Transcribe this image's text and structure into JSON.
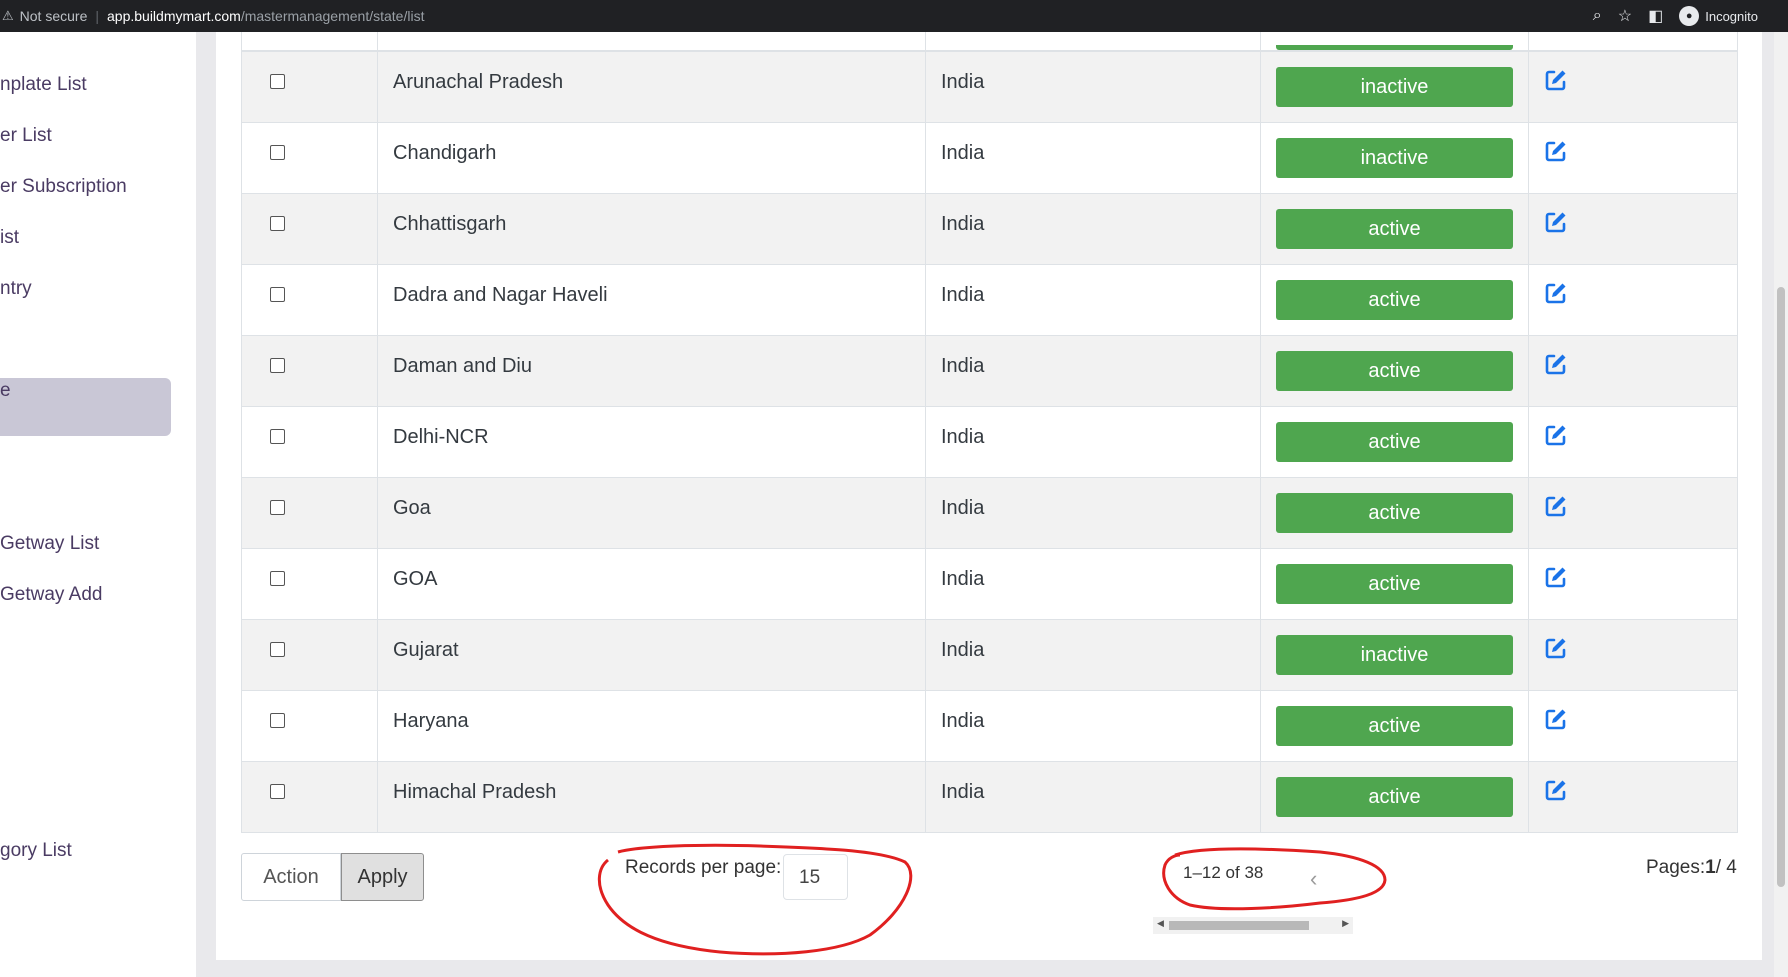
{
  "browser": {
    "security_label": "Not secure",
    "url_host": "app.buildmymart.com",
    "url_path": "/mastermanagement/state/list",
    "profile_label": "Incognito"
  },
  "sidebar": {
    "items": [
      {
        "label": "nplate List"
      },
      {
        "label": "er List"
      },
      {
        "label": "er Subscription"
      },
      {
        "label": "ist"
      },
      {
        "label": "ntry"
      },
      {
        "label": ""
      },
      {
        "label": "e"
      },
      {
        "label": "Getway List"
      },
      {
        "label": "Getway Add"
      },
      {
        "label": "gory List"
      }
    ]
  },
  "table": {
    "rows": [
      {
        "name": "Arunachal Pradesh",
        "country": "India",
        "status": "inactive"
      },
      {
        "name": "Chandigarh",
        "country": "India",
        "status": "inactive"
      },
      {
        "name": "Chhattisgarh",
        "country": "India",
        "status": "active"
      },
      {
        "name": "Dadra and Nagar Haveli",
        "country": "India",
        "status": "active"
      },
      {
        "name": "Daman and Diu",
        "country": "India",
        "status": "active"
      },
      {
        "name": "Delhi-NCR",
        "country": "India",
        "status": "active"
      },
      {
        "name": "Goa",
        "country": "India",
        "status": "active"
      },
      {
        "name": "GOA",
        "country": "India",
        "status": "active"
      },
      {
        "name": "Gujarat",
        "country": "India",
        "status": "inactive"
      },
      {
        "name": "Haryana",
        "country": "India",
        "status": "active"
      },
      {
        "name": "Himachal Pradesh",
        "country": "India",
        "status": "active"
      }
    ]
  },
  "footer": {
    "action_label": "Action",
    "apply_label": "Apply",
    "records_per_page_label": "Records per page:",
    "records_per_page_value": "15",
    "range_text": "1–12 of 38",
    "pages_label": "Pages:",
    "current_page": "1",
    "total_pages": "/ 4"
  },
  "colors": {
    "status_pill": "#4fa64f",
    "edit_icon": "#1a73e8",
    "annotation": "#e02020",
    "sidebar_active": "#c9c7d6"
  }
}
